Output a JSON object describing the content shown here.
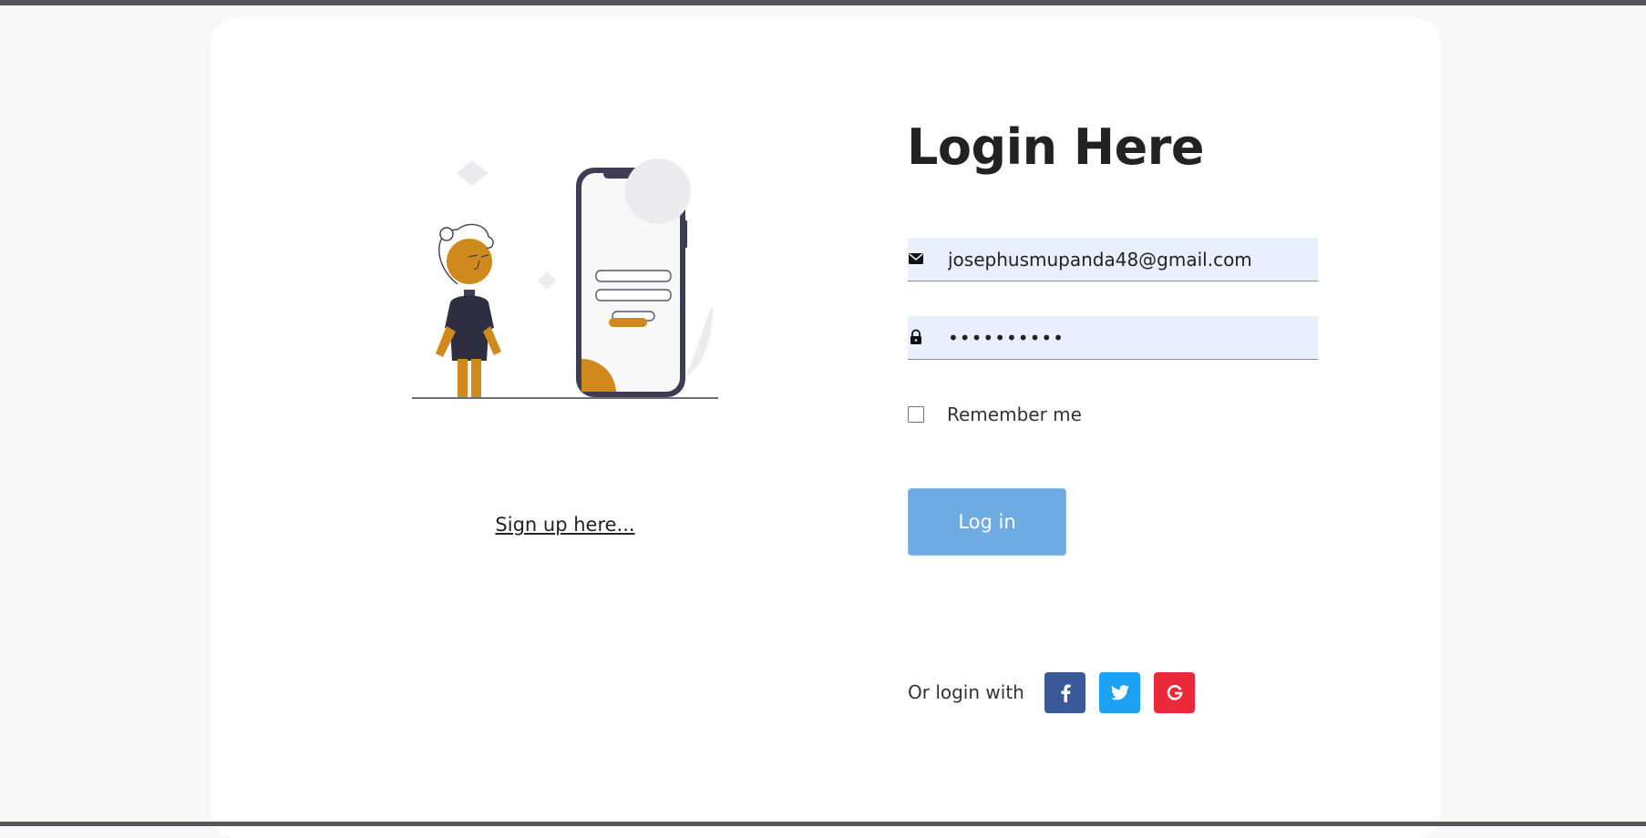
{
  "login": {
    "title": "Login Here",
    "email": {
      "icon": "envelope-icon",
      "value": "josephusmupanda48@gmail.com"
    },
    "password": {
      "icon": "lock-icon",
      "value": "••••••••••"
    },
    "remember_label": "Remember me",
    "remember_checked": false,
    "submit_label": "Log in",
    "social": {
      "label": "Or login with",
      "providers": [
        {
          "name": "facebook",
          "icon": "facebook-icon",
          "color": "#3b5998"
        },
        {
          "name": "twitter",
          "icon": "twitter-icon",
          "color": "#1da1f2"
        },
        {
          "name": "google",
          "icon": "google-icon",
          "color": "#ea2a3a"
        }
      ]
    }
  },
  "signup": {
    "link_text": "Sign up here..."
  },
  "colors": {
    "accent": "#d08a1c",
    "button": "#6eabe3",
    "input_background": "#e8f0fd",
    "dark": "#2f2e41"
  }
}
